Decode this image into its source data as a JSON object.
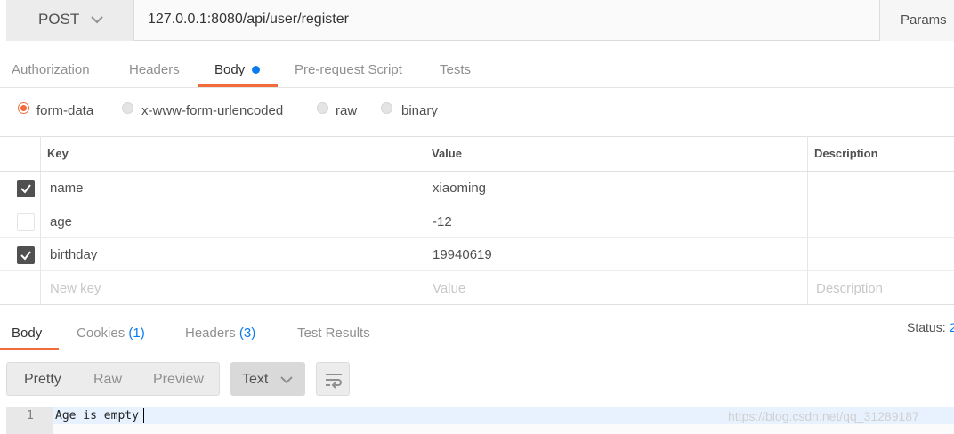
{
  "request": {
    "method": "POST",
    "url": "127.0.0.1:8080/api/user/register",
    "params_label": "Params"
  },
  "request_tabs": [
    {
      "label": "Authorization",
      "active": false
    },
    {
      "label": "Headers",
      "active": false
    },
    {
      "label": "Body",
      "active": true,
      "has_dot": true
    },
    {
      "label": "Pre-request Script",
      "active": false
    },
    {
      "label": "Tests",
      "active": false
    }
  ],
  "body_types": [
    {
      "label": "form-data",
      "selected": true
    },
    {
      "label": "x-www-form-urlencoded",
      "selected": false
    },
    {
      "label": "raw",
      "selected": false
    },
    {
      "label": "binary",
      "selected": false
    }
  ],
  "table": {
    "headers": {
      "key": "Key",
      "value": "Value",
      "description": "Description"
    },
    "rows": [
      {
        "checked": true,
        "key": "name",
        "value": "xiaoming",
        "description": ""
      },
      {
        "checked": false,
        "key": "age",
        "value": "-12",
        "description": ""
      },
      {
        "checked": true,
        "key": "birthday",
        "value": "19940619",
        "description": ""
      }
    ],
    "placeholders": {
      "key": "New key",
      "value": "Value",
      "description": "Description"
    }
  },
  "response_tabs": [
    {
      "label": "Body",
      "count": "",
      "active": true
    },
    {
      "label": "Cookies",
      "count": "(1)",
      "active": false
    },
    {
      "label": "Headers",
      "count": "(3)",
      "active": false
    },
    {
      "label": "Test Results",
      "count": "",
      "active": false
    }
  ],
  "status": {
    "label": "Status:",
    "value": "2"
  },
  "format_buttons": [
    {
      "label": "Pretty",
      "active": true
    },
    {
      "label": "Raw",
      "active": false
    },
    {
      "label": "Preview",
      "active": false
    }
  ],
  "response_type": "Text",
  "editor": {
    "line_number": "1",
    "text": "Age is empty"
  },
  "watermark": "https://blog.csdn.net/qq_31289187",
  "colors": {
    "accent": "#f26b3a",
    "link": "#097bed"
  },
  "icons": [
    "chevron-down-icon",
    "checkbox-check-icon",
    "wrap-lines-icon"
  ]
}
